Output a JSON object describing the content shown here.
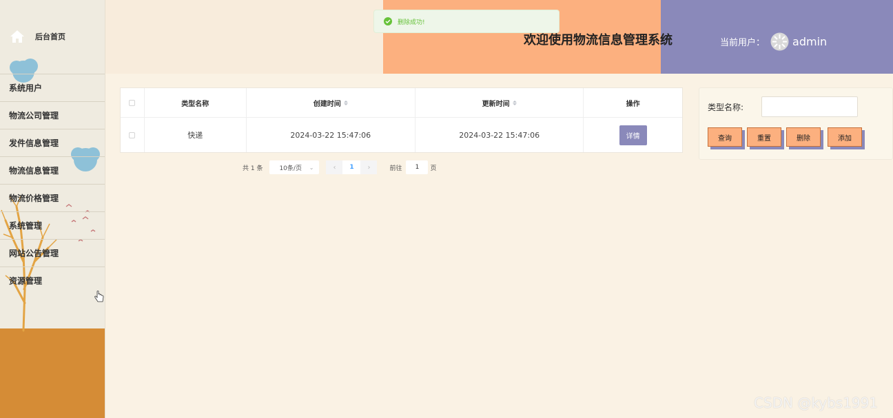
{
  "sidebar": {
    "home_label": "后台首页",
    "items": [
      {
        "label": "系统用户"
      },
      {
        "label": "物流公司管理"
      },
      {
        "label": "发件信息管理"
      },
      {
        "label": "物流信息管理"
      },
      {
        "label": "物流价格管理"
      },
      {
        "label": "系统管理"
      },
      {
        "label": "网站公告管理"
      },
      {
        "label": "资源管理"
      }
    ]
  },
  "header": {
    "title": "欢迎使用物流信息管理系统",
    "user_prefix": "当前用户：",
    "username": "admin"
  },
  "toast": {
    "text": "删除成功!"
  },
  "table": {
    "columns": {
      "type_name": "类型名称",
      "created": "创建时间",
      "updated": "更新时间",
      "actions": "操作"
    },
    "rows": [
      {
        "type_name": "快递",
        "created": "2024-03-22 15:47:06",
        "updated": "2024-03-22 15:47:06",
        "action_label": "详情"
      }
    ]
  },
  "pagination": {
    "total_text": "共 1 条",
    "page_size": "10条/页",
    "current_page": "1",
    "goto_label": "前往",
    "goto_value": "1",
    "page_suffix": "页"
  },
  "search": {
    "label": "类型名称:",
    "value": "",
    "buttons": {
      "query": "查询",
      "reset": "重置",
      "delete": "删除",
      "add": "添加"
    }
  },
  "watermark": "CSDN @kybs1991",
  "colors": {
    "header_orange": "#fcb07f",
    "header_purple": "#8a89ba",
    "sidebar_ground": "#d58c36",
    "success_green": "#67c23a",
    "page_bg": "#faf2e4"
  },
  "icons": [
    "home-icon",
    "check-circle-icon",
    "avatar-icon",
    "sort-icon",
    "hand-cursor-icon"
  ]
}
